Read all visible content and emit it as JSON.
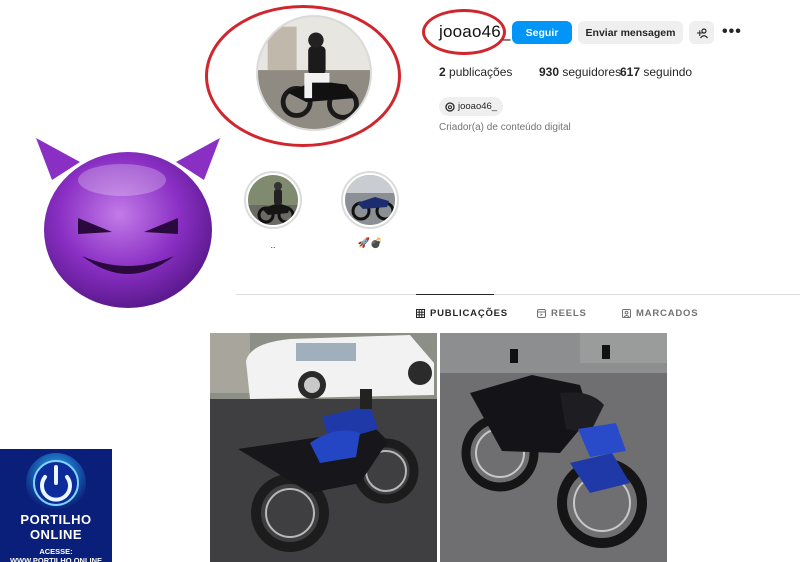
{
  "profile": {
    "username": "jooao46_",
    "follow_label": "Seguir",
    "message_label": "Enviar mensagem",
    "add_user_glyph": "+⌂",
    "more_glyph": "•••",
    "stats": {
      "posts_count": "2",
      "posts_label": "publicações",
      "followers_count": "930",
      "followers_label": "seguidores",
      "following_count": "617",
      "following_label": "seguindo"
    },
    "threads_handle": "jooao46_",
    "category": "Criador(a) de conteúdo digital"
  },
  "highlights": [
    {
      "label": "..",
      "icon": "motorcycle-photo"
    },
    {
      "label": "🚀💣",
      "icon": "motorcycle-photo"
    }
  ],
  "tabs": [
    {
      "label": "PUBLICAÇÕES",
      "icon": "grid-icon",
      "active": true
    },
    {
      "label": "REELS",
      "icon": "reels-icon",
      "active": false
    },
    {
      "label": "MARCADOS",
      "icon": "tagged-icon",
      "active": false
    }
  ],
  "overlay": {
    "emoji": "smiling-devil-emoji",
    "logo_line1": "PORTILHO",
    "logo_line2": "ONLINE",
    "logo_line3": "ACESSE: WWW.PORTILHO.ONLINE"
  },
  "colors": {
    "accent": "#0095f6",
    "annotation_red": "#d0262d",
    "emoji_purple": "#8a2fc4",
    "logo_blue": "#0a1f7a"
  }
}
